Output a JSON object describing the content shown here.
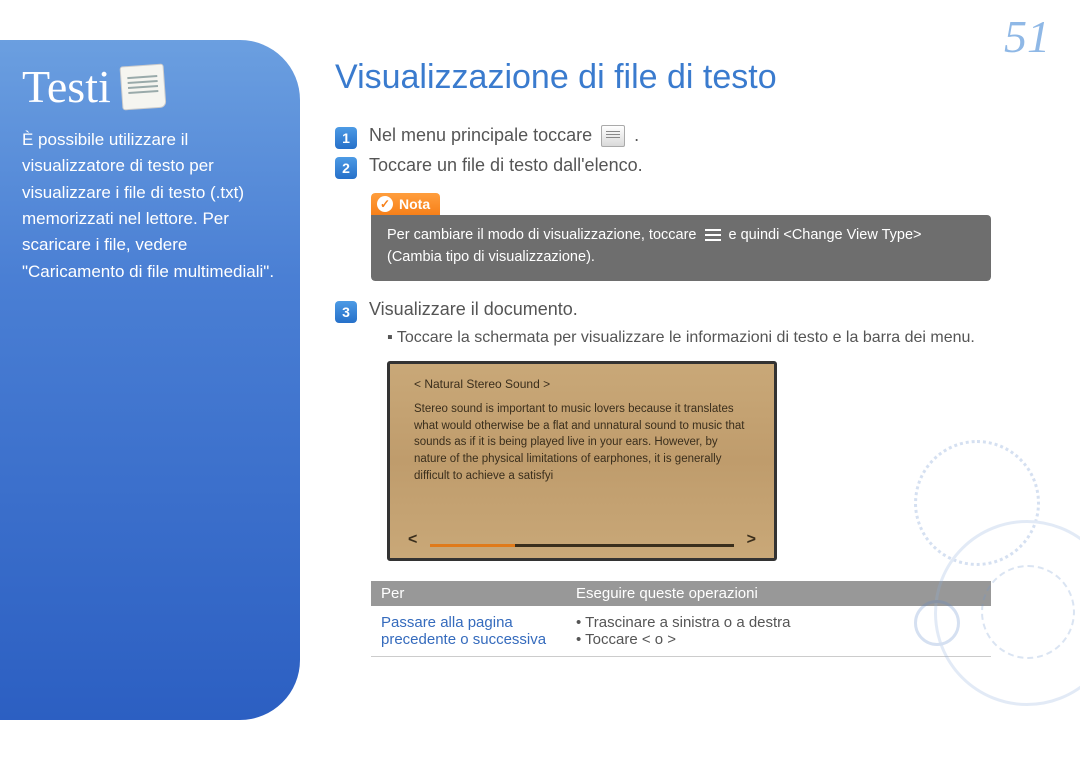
{
  "pageNumber": "51",
  "sidebar": {
    "title": "Testi",
    "text": "È possibile utilizzare il visualizzatore di testo per visualizzare i file di testo (.txt) memorizzati nel lettore. Per scaricare i file, vedere \"Caricamento di file multimediali\"."
  },
  "main": {
    "title": "Visualizzazione di file di testo",
    "steps": [
      {
        "num": "1",
        "textBefore": "Nel menu principale toccare ",
        "textAfter": "."
      },
      {
        "num": "2",
        "text": "Toccare un file di testo dall'elenco."
      },
      {
        "num": "3",
        "text": "Visualizzare il documento."
      }
    ],
    "note": {
      "label": "Nota",
      "body": "Per cambiare il modo di visualizzazione, toccare ☰ e quindi <Change View Type> (Cambia tipo di visualizzazione)."
    },
    "subBullet": "Toccare la schermata per visualizzare le informazioni di testo e la barra dei menu.",
    "parchment": {
      "title": "< Natural Stereo Sound >",
      "body": "Stereo sound is important to music lovers because it translates what would otherwise be a flat and unnatural sound to music that sounds as if it is being played live in your ears. However, by nature of the physical limitations of earphones, it is generally difficult to achieve a satisfyi",
      "left": "<",
      "right": ">"
    },
    "table": {
      "headers": [
        "Per",
        "Eseguire queste operazioni"
      ],
      "row": {
        "left": "Passare alla pagina precedente o successiva",
        "right1": "Trascinare a sinistra o a destra",
        "right2": "Toccare  <  o  >"
      }
    }
  }
}
